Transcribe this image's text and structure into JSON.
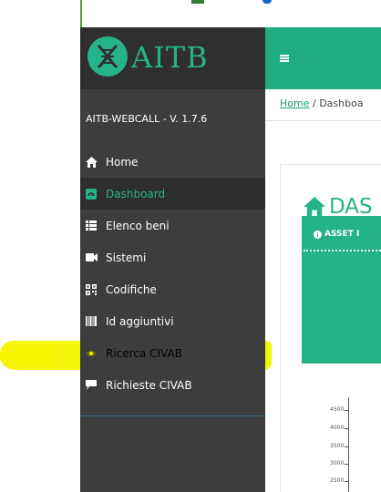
{
  "app": {
    "logo_text": "AITB",
    "version": "AITB-WEBCALL - V. 1.7.6"
  },
  "sidebar": {
    "items": [
      {
        "label": "Home",
        "icon": "home-icon"
      },
      {
        "label": "Dashboard",
        "icon": "dashboard-icon"
      },
      {
        "label": "Elenco beni",
        "icon": "list-icon"
      },
      {
        "label": "Sistemi",
        "icon": "video-camera-icon"
      },
      {
        "label": "Codifiche",
        "icon": "qr-code-icon"
      },
      {
        "label": "Id aggiuntivi",
        "icon": "barcode-icon"
      },
      {
        "label": "Ricerca CIVAB",
        "icon": "eye-icon"
      },
      {
        "label": "Richieste CIVAB",
        "icon": "comment-icon"
      }
    ]
  },
  "breadcrumb": {
    "home_link": "Home",
    "separator": " / ",
    "current": "Dashboa"
  },
  "main": {
    "page_title": "DAS",
    "asset_label": "ASSET I"
  },
  "chart_axis": {
    "ticks": [
      "4500",
      "4000",
      "3500",
      "3000",
      "2500"
    ]
  },
  "colors": {
    "accent": "#27b389",
    "header": "#1fad82",
    "sidebar": "#3d3d3d",
    "highlight": "#f6f600"
  }
}
